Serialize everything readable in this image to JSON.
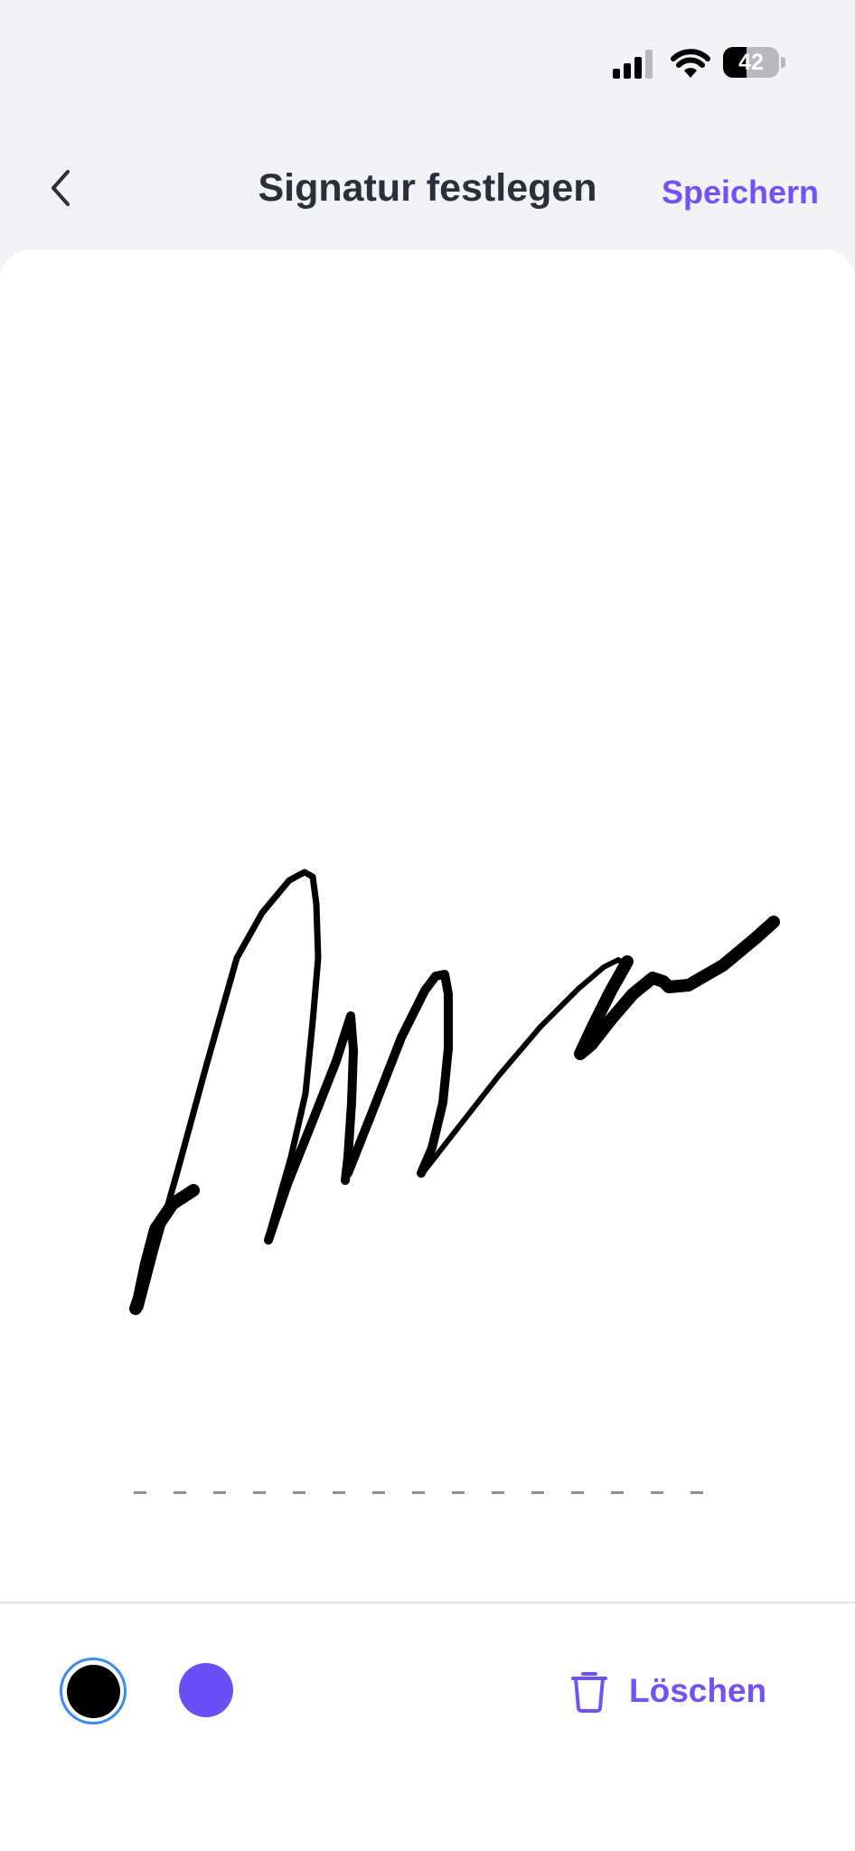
{
  "status_bar": {
    "battery_level": "42",
    "battery_fraction": 0.42,
    "icons": [
      "signal-icon",
      "wifi-icon",
      "battery-icon"
    ]
  },
  "nav": {
    "back_icon": "chevron-left-icon",
    "title": "Signatur festlegen",
    "save_label": "Speichern"
  },
  "canvas": {
    "stroke_color": "#000000"
  },
  "toolbar": {
    "colors": [
      "#000000",
      "#6b4ff6"
    ],
    "selected_color": "#000000",
    "selection_ring_color": "#3b8bf0",
    "delete_icon": "trash-icon",
    "delete_label": "Löschen"
  },
  "theme": {
    "accent": "#7052f5",
    "title_color": "#2b2f3a",
    "background": "#f2f2f7"
  }
}
